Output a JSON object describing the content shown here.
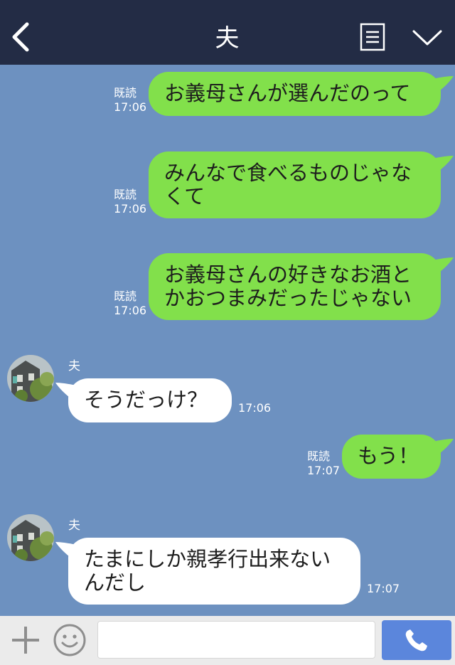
{
  "header": {
    "title": "夫",
    "back_icon": "chevron-left-icon",
    "menu_icon": "notes-icon",
    "more_icon": "chevron-down-icon"
  },
  "messages": [
    {
      "direction": "out",
      "text": "お義母さんが選んだのって",
      "read": "既読",
      "time": "17:06"
    },
    {
      "direction": "out",
      "text": "みんなで食べるものじゃなくて",
      "read": "既読",
      "time": "17:06"
    },
    {
      "direction": "out",
      "text": "お義母さんの好きなお酒とかおつまみだったじゃない",
      "read": "既読",
      "time": "17:06"
    },
    {
      "direction": "in",
      "sender": "夫",
      "text": "そうだっけ？",
      "time": "17:06"
    },
    {
      "direction": "out",
      "text": "もう！",
      "read": "既読",
      "time": "17:07"
    },
    {
      "direction": "in",
      "sender": "夫",
      "text": "たまにしか親孝行出来ないんだし",
      "time": "17:07"
    }
  ],
  "footer": {
    "input_value": "",
    "input_placeholder": "",
    "plus_icon": "plus-icon",
    "emoji_icon": "smiley-icon",
    "call_icon": "phone-icon"
  },
  "colors": {
    "header_bg": "#232c45",
    "chat_bg": "#6d91c0",
    "outgoing_bubble": "#82e04b",
    "incoming_bubble": "#ffffff",
    "call_button": "#5b86dc"
  }
}
